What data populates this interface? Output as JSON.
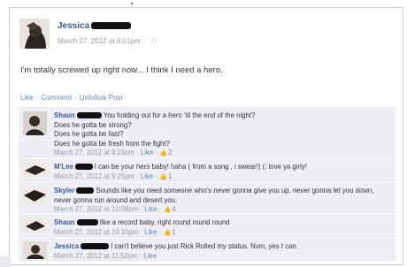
{
  "post": {
    "author": "Jessica",
    "timestamp": "March 27, 2012 at 9:01pm",
    "privacy_icon": "friends-icon",
    "text": "I'm totally screwed up right now... I think I need a hero.",
    "actions": {
      "like": "Like",
      "comment": "Comment",
      "unfollow": "Unfollow Post",
      "separator": "·"
    }
  },
  "comments": [
    {
      "author": "Shaun",
      "lines": [
        "You holding out for a hero 'til the end of the night?",
        "Does he gotta be strong?",
        "Does he gotta be fast?",
        "Does he gotta be fresh from the fight?"
      ],
      "timestamp": "March 27, 2012 at 9:19pm",
      "like_label": "Like",
      "like_count": "2"
    },
    {
      "author": "M'Lee",
      "lines": [
        "I can be your hero baby! haha ( from a song , i swear!) (: love ya girly!"
      ],
      "timestamp": "March 27, 2012 at 9:25pm",
      "like_label": "Like",
      "like_count": "1"
    },
    {
      "author": "Skyler",
      "lines": [
        "Sounds like you need someone who's never gonna give you up, never gonna let you down,",
        "never gonna run around and desert you."
      ],
      "timestamp": "March 27, 2012 at 10:08pm",
      "like_label": "Like",
      "like_count": "4"
    },
    {
      "author": "Shaun",
      "lines": [
        "like a record baby, right round round round"
      ],
      "timestamp": "March 27, 2012 at 10:10pm",
      "like_label": "Like",
      "like_count": "1"
    },
    {
      "author": "Jessica",
      "lines": [
        "I can't believe you just Rick Rolled my status. Nvm, yes I can."
      ],
      "timestamp": "March 27, 2012 at 11:52pm",
      "like_label": "Like",
      "like_count": ""
    }
  ],
  "colors": {
    "link": "#3b5998",
    "meta": "#999999",
    "comment_bg": "#edeff4",
    "action": "#6d84b4"
  }
}
